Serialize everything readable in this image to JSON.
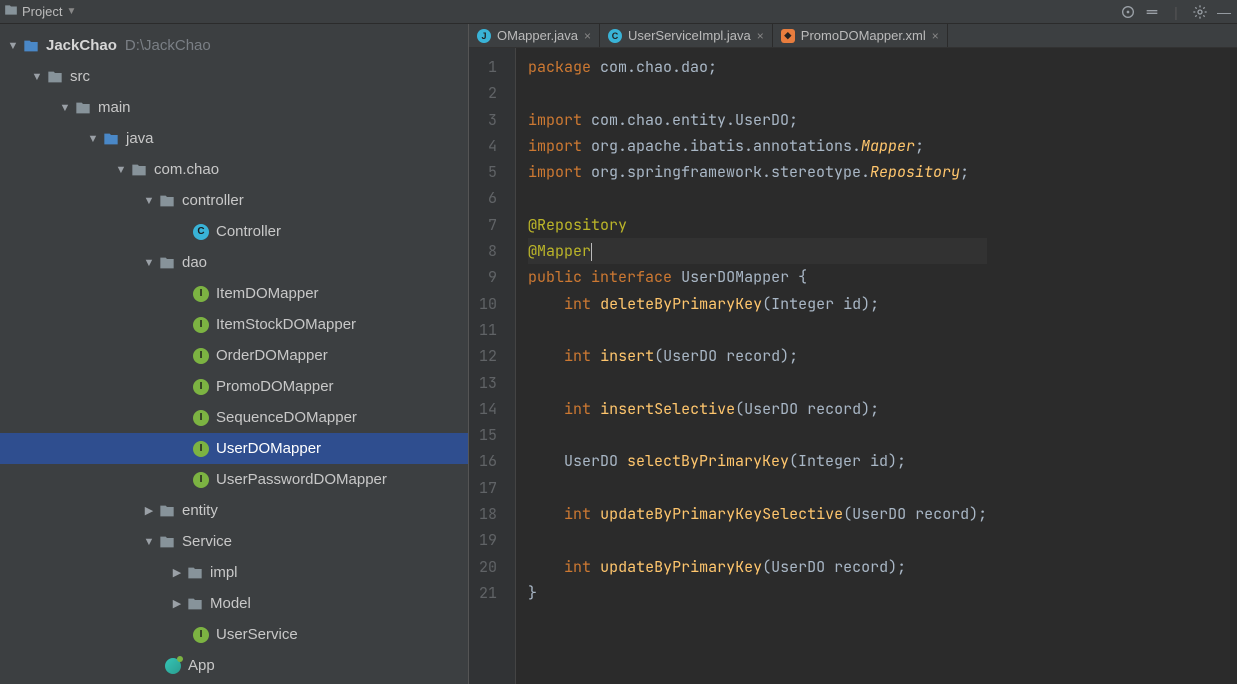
{
  "toolbar": {
    "project_label": "Project"
  },
  "project": {
    "root": {
      "name": "JackChao",
      "path": "D:\\JackChao"
    },
    "nodes": {
      "src": "src",
      "main": "main",
      "java": "java",
      "pkg": "com.chao",
      "controller_dir": "controller",
      "controller_cls": "Controller",
      "dao_dir": "dao",
      "dao_items": [
        "ItemDOMapper",
        "ItemStockDOMapper",
        "OrderDOMapper",
        "PromoDOMapper",
        "SequenceDOMapper",
        "UserDOMapper",
        "UserPasswordDOMapper"
      ],
      "entity": "entity",
      "service": "Service",
      "impl": "impl",
      "model": "Model",
      "user_service": "UserService",
      "app": "App"
    }
  },
  "tabs": [
    {
      "label": "OMapper.java",
      "icon": "j"
    },
    {
      "label": "UserServiceImpl.java",
      "icon": "c"
    },
    {
      "label": "PromoDOMapper.xml",
      "icon": "xml"
    }
  ],
  "code": {
    "lines": [
      {
        "n": 1,
        "html": "<span class='kw'>package</span> com.chao.dao;"
      },
      {
        "n": 2,
        "html": ""
      },
      {
        "n": 3,
        "html": "<span class='kw'>import</span> com.chao.entity.UserDO;"
      },
      {
        "n": 4,
        "html": "<span class='kw'>import</span> org.apache.ibatis.annotations.<span class='repo'>Mapper</span>;"
      },
      {
        "n": 5,
        "html": "<span class='kw'>import</span> org.springframework.stereotype.<span class='repo'>Repository</span>;"
      },
      {
        "n": 6,
        "html": ""
      },
      {
        "n": 7,
        "html": "<span class='ann'>@Repository</span>"
      },
      {
        "n": 8,
        "html": "<span class='ann'>@Mapper</span><span class='cursor-caret'></span>"
      },
      {
        "n": 9,
        "html": "<span class='kw'>public</span> <span class='kw'>interface</span> UserDOMapper {"
      },
      {
        "n": 10,
        "html": "    <span class='kw'>int</span> <span class='fn'>deleteByPrimaryKey</span>(Integer id);"
      },
      {
        "n": 11,
        "html": ""
      },
      {
        "n": 12,
        "html": "    <span class='kw'>int</span> <span class='fn'>insert</span>(UserDO record);"
      },
      {
        "n": 13,
        "html": ""
      },
      {
        "n": 14,
        "html": "    <span class='kw'>int</span> <span class='fn'>insertSelective</span>(UserDO record);"
      },
      {
        "n": 15,
        "html": ""
      },
      {
        "n": 16,
        "html": "    UserDO <span class='fn'>selectByPrimaryKey</span>(Integer id);"
      },
      {
        "n": 17,
        "html": ""
      },
      {
        "n": 18,
        "html": "    <span class='kw'>int</span> <span class='fn'>updateByPrimaryKeySelective</span>(UserDO record);"
      },
      {
        "n": 19,
        "html": ""
      },
      {
        "n": 20,
        "html": "    <span class='kw'>int</span> <span class='fn'>updateByPrimaryKey</span>(UserDO record);"
      },
      {
        "n": 21,
        "html": "}"
      }
    ]
  }
}
